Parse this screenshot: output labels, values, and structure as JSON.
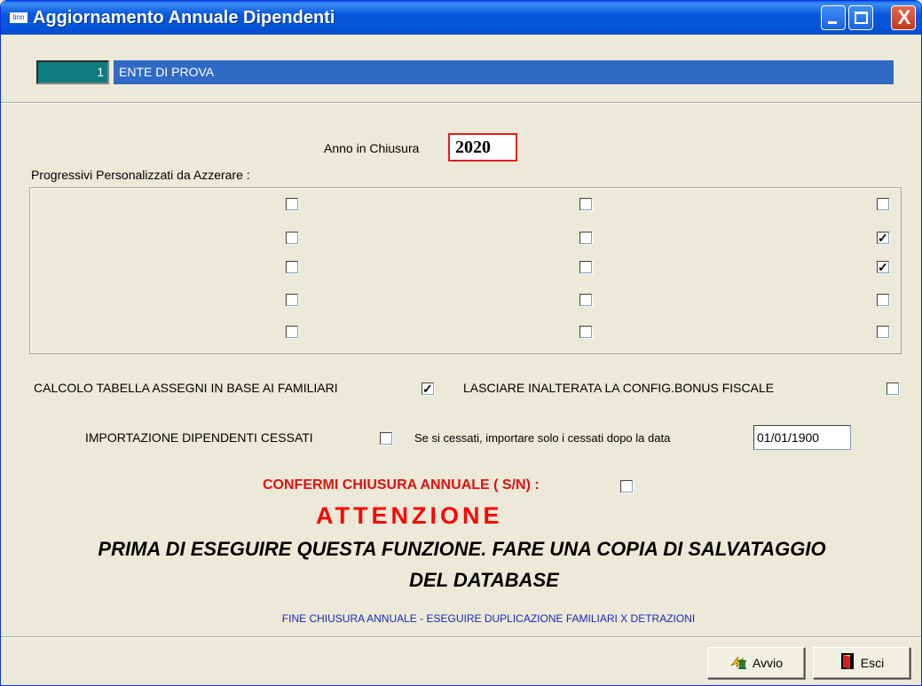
{
  "window": {
    "title": "Aggiornamento Annuale Dipendenti",
    "app_icon_text": "tinn",
    "close_glyph": "X"
  },
  "header": {
    "ente_code": "1",
    "ente_name": "ENTE DI PROVA"
  },
  "anno": {
    "label": "Anno in Chiusura",
    "value": "2020"
  },
  "progressivi": {
    "label": "Progressivi Personalizzati  da Azzerare  :",
    "rows": [
      [
        false,
        false,
        false
      ],
      [
        false,
        false,
        true
      ],
      [
        false,
        false,
        true
      ],
      [
        false,
        false,
        false
      ],
      [
        false,
        false,
        false
      ]
    ]
  },
  "options": {
    "calcolo_label": "CALCOLO TABELLA ASSEGNI IN BASE AI FAMILIARI",
    "calcolo_checked": true,
    "bonus_label": "LASCIARE INALTERATA LA CONFIG.BONUS FISCALE",
    "bonus_checked": false,
    "import_label": "IMPORTAZIONE DIPENDENTI CESSATI",
    "import_checked": false,
    "cessati_label": "Se si cessati, importare solo i cessati dopo la data",
    "cessati_date": "01/01/1900"
  },
  "confirm": {
    "label": "CONFERMI CHIUSURA ANNUALE ( S/N) :",
    "checked": false
  },
  "warning": {
    "title": "ATTENZIONE",
    "line1": "PRIMA DI ESEGUIRE QUESTA FUNZIONE. FARE UNA COPIA DI SALVATAGGIO",
    "line2": "DEL DATABASE",
    "footer_note": "FINE CHIUSURA ANNUALE - ESEGUIRE DUPLICAZIONE FAMILIARI X DETRAZIONI"
  },
  "buttons": {
    "avvio": "Avvio",
    "avvio_icon": "hourglass-run-icon",
    "esci": "Esci",
    "esci_icon": "exit-door-icon"
  },
  "colors": {
    "titlebar": "#0453d9",
    "accent_blue": "#316ac5",
    "code_teal": "#0e7d80",
    "warning_red": "#ff0000",
    "note_blue": "#1a2aba"
  }
}
